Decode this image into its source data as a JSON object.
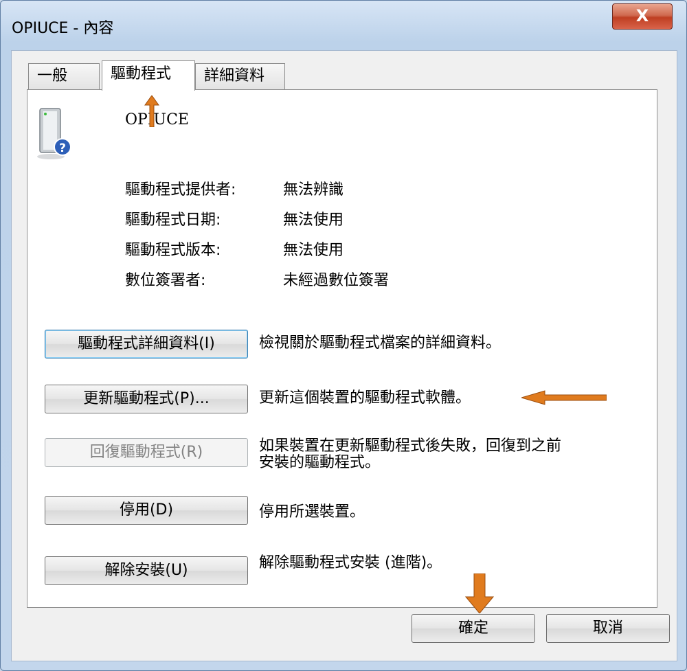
{
  "window": {
    "title": "OPIUCE - 內容",
    "close_label": "X"
  },
  "tabs": [
    {
      "label": "一般"
    },
    {
      "label": "驅動程式"
    },
    {
      "label": "詳細資料"
    }
  ],
  "device": {
    "name": "OPIUCE",
    "icon": "unknown-device-icon"
  },
  "info": [
    {
      "label": "驅動程式提供者:",
      "value": "無法辨識"
    },
    {
      "label": "驅動程式日期:",
      "value": "無法使用"
    },
    {
      "label": "驅動程式版本:",
      "value": "無法使用"
    },
    {
      "label": "數位簽署者:",
      "value": "未經過數位簽署"
    }
  ],
  "actions": [
    {
      "label": "驅動程式詳細資料(I)",
      "desc": "檢視關於驅動程式檔案的詳細資料。"
    },
    {
      "label": "更新驅動程式(P)...",
      "desc": "更新這個裝置的驅動程式軟體。"
    },
    {
      "label": "回復驅動程式(R)",
      "desc_line1": "如果裝置在更新驅動程式後失敗，回復到之前",
      "desc_line2": "安裝的驅動程式。"
    },
    {
      "label": "停用(D)",
      "desc": "停用所選裝置。"
    },
    {
      "label": "解除安裝(U)",
      "desc": "解除驅動程式安裝 (進階)。"
    }
  ],
  "footer": {
    "ok_label": "確定",
    "cancel_label": "取消"
  },
  "colors": {
    "arrow": "#e07b1e",
    "accent": "#3c7fb1",
    "close": "#c8452a"
  }
}
